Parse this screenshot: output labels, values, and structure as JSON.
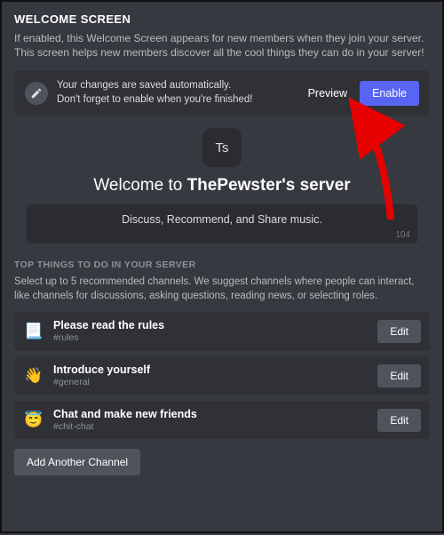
{
  "header": {
    "title": "WELCOME SCREEN",
    "description": "If enabled, this Welcome Screen appears for new members when they join your server. This screen helps new members discover all the cool things they can do in your server!"
  },
  "banner": {
    "line1": "Your changes are saved automatically.",
    "line2": "Don't forget to enable when you're finished!",
    "preview_label": "Preview",
    "enable_label": "Enable"
  },
  "server": {
    "icon_initials": "Ts",
    "welcome_prefix": "Welcome to ",
    "name": "ThePewster's server",
    "description_value": "Discuss, Recommend, and Share music.",
    "char_count": "104"
  },
  "top_things": {
    "heading": "TOP THINGS TO DO IN YOUR SERVER",
    "subheading": "Select up to 5 recommended channels. We suggest channels where people can interact, like channels for discussions, asking questions, reading news, or selecting roles.",
    "edit_label": "Edit",
    "add_label": "Add Another Channel",
    "items": [
      {
        "emoji": "📃",
        "title": "Please read the rules",
        "channel": "#rules"
      },
      {
        "emoji": "👋",
        "title": "Introduce yourself",
        "channel": "#general"
      },
      {
        "emoji": "😇",
        "title": "Chat and make new friends",
        "channel": "#chit-chat"
      }
    ]
  },
  "colors": {
    "accent": "#5865f2",
    "bg": "#36393f",
    "panel": "#2f3136"
  }
}
